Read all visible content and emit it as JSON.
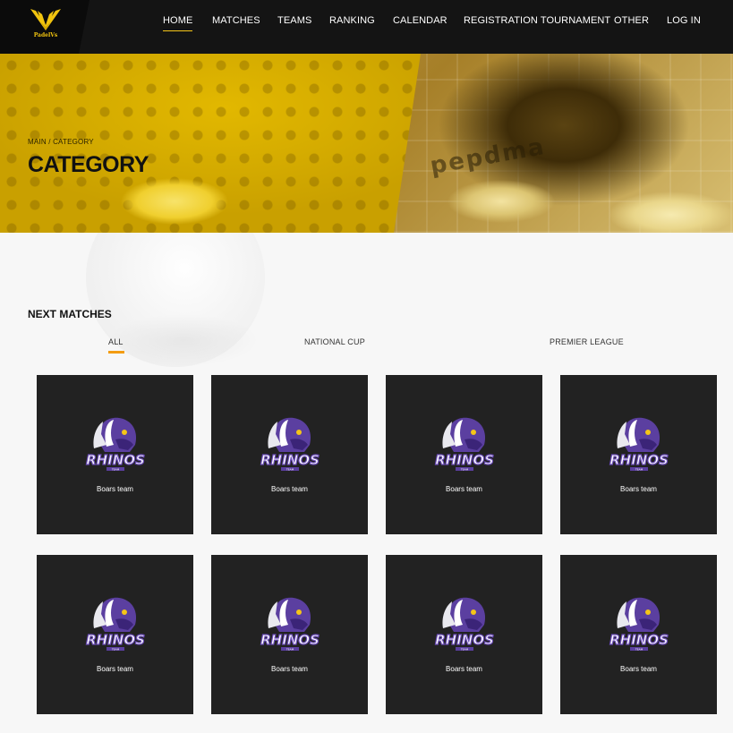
{
  "brand": {
    "logo_text": "PadelVs",
    "accent": "#f5c518"
  },
  "nav": {
    "items": [
      {
        "label": "HOME",
        "active": true
      },
      {
        "label": "MATCHES"
      },
      {
        "label": "TEAMS"
      },
      {
        "label": "RANKING"
      },
      {
        "label": "CALENDAR"
      },
      {
        "label": "REGISTRATION TOURNAMENT"
      },
      {
        "label": "OTHER"
      },
      {
        "label": "LOG IN"
      }
    ]
  },
  "hero": {
    "breadcrumb": "MAIN / CATEGORY",
    "title": "CATEGORY",
    "background_text": "pepdma"
  },
  "section": {
    "title": "NEXT MATCHES",
    "tabs": [
      {
        "label": "ALL",
        "active": true
      },
      {
        "label": "NATIONAL CUP"
      },
      {
        "label": "PREMIER LEAGUE"
      }
    ]
  },
  "cards": [
    {
      "logo_text": "RHINOS",
      "team_name": "Boars team"
    },
    {
      "logo_text": "RHINOS",
      "team_name": "Boars team"
    },
    {
      "logo_text": "RHINOS",
      "team_name": "Boars team"
    },
    {
      "logo_text": "RHINOS",
      "team_name": "Boars team"
    },
    {
      "logo_text": "RHINOS",
      "team_name": "Boars team"
    },
    {
      "logo_text": "RHINOS",
      "team_name": "Boars team"
    },
    {
      "logo_text": "RHINOS",
      "team_name": "Boars team"
    },
    {
      "logo_text": "RHINOS",
      "team_name": "Boars team"
    }
  ]
}
